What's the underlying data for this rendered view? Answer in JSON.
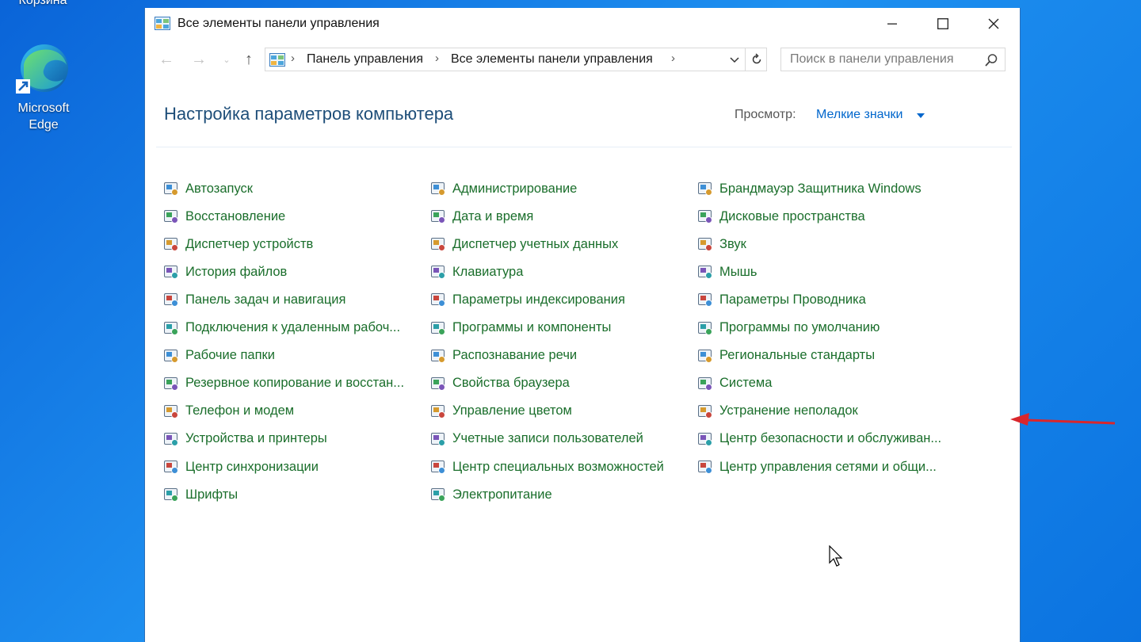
{
  "desktop": {
    "recycle_bin_label": "Корзина",
    "edge_label": "Microsoft Edge"
  },
  "window": {
    "title": "Все элементы панели управления",
    "icon": "control-panel-icon"
  },
  "nav": {
    "breadcrumb": [
      "Панель управления",
      "Все элементы панели управления"
    ],
    "search_placeholder": "Поиск в панели управления"
  },
  "content": {
    "heading": "Настройка параметров компьютера",
    "view_label": "Просмотр:",
    "view_value": "Мелкие значки",
    "link_color": "#1a6e2b",
    "items_col1": [
      {
        "label": "Автозапуск",
        "icon": "autoplay-icon"
      },
      {
        "label": "Восстановление",
        "icon": "recovery-icon"
      },
      {
        "label": "Диспетчер устройств",
        "icon": "device-manager-icon"
      },
      {
        "label": "История файлов",
        "icon": "file-history-icon"
      },
      {
        "label": "Панель задач и навигация",
        "icon": "taskbar-icon"
      },
      {
        "label": "Подключения к удаленным рабоч...",
        "icon": "remote-connections-icon"
      },
      {
        "label": "Рабочие папки",
        "icon": "work-folders-icon"
      },
      {
        "label": "Резервное копирование и восстан...",
        "icon": "backup-icon"
      },
      {
        "label": "Телефон и модем",
        "icon": "phone-modem-icon"
      },
      {
        "label": "Устройства и принтеры",
        "icon": "printers-icon"
      },
      {
        "label": "Центр синхронизации",
        "icon": "sync-center-icon"
      },
      {
        "label": "Шрифты",
        "icon": "fonts-icon"
      }
    ],
    "items_col2": [
      {
        "label": "Администрирование",
        "icon": "admin-tools-icon"
      },
      {
        "label": "Дата и время",
        "icon": "date-time-icon"
      },
      {
        "label": "Диспетчер учетных данных",
        "icon": "credential-manager-icon"
      },
      {
        "label": "Клавиатура",
        "icon": "keyboard-icon"
      },
      {
        "label": "Параметры индексирования",
        "icon": "indexing-icon"
      },
      {
        "label": "Программы и компоненты",
        "icon": "programs-icon"
      },
      {
        "label": "Распознавание речи",
        "icon": "speech-icon"
      },
      {
        "label": "Свойства браузера",
        "icon": "internet-options-icon"
      },
      {
        "label": "Управление цветом",
        "icon": "color-management-icon"
      },
      {
        "label": "Учетные записи пользователей",
        "icon": "user-accounts-icon"
      },
      {
        "label": "Центр специальных возможностей",
        "icon": "accessibility-icon"
      },
      {
        "label": "Электропитание",
        "icon": "power-options-icon"
      }
    ],
    "items_col3": [
      {
        "label": "Брандмауэр Защитника Windows",
        "icon": "firewall-icon"
      },
      {
        "label": "Дисковые пространства",
        "icon": "storage-spaces-icon"
      },
      {
        "label": "Звук",
        "icon": "sound-icon"
      },
      {
        "label": "Мышь",
        "icon": "mouse-icon"
      },
      {
        "label": "Параметры Проводника",
        "icon": "explorer-options-icon"
      },
      {
        "label": "Программы по умолчанию",
        "icon": "default-programs-icon"
      },
      {
        "label": "Региональные стандарты",
        "icon": "region-icon"
      },
      {
        "label": "Система",
        "icon": "system-icon"
      },
      {
        "label": "Устранение неполадок",
        "icon": "troubleshooting-icon"
      },
      {
        "label": "Центр безопасности и обслуживан...",
        "icon": "security-maintenance-icon"
      },
      {
        "label": "Центр управления сетями и общи...",
        "icon": "network-center-icon"
      }
    ],
    "annotation_color": "#d9262c"
  }
}
